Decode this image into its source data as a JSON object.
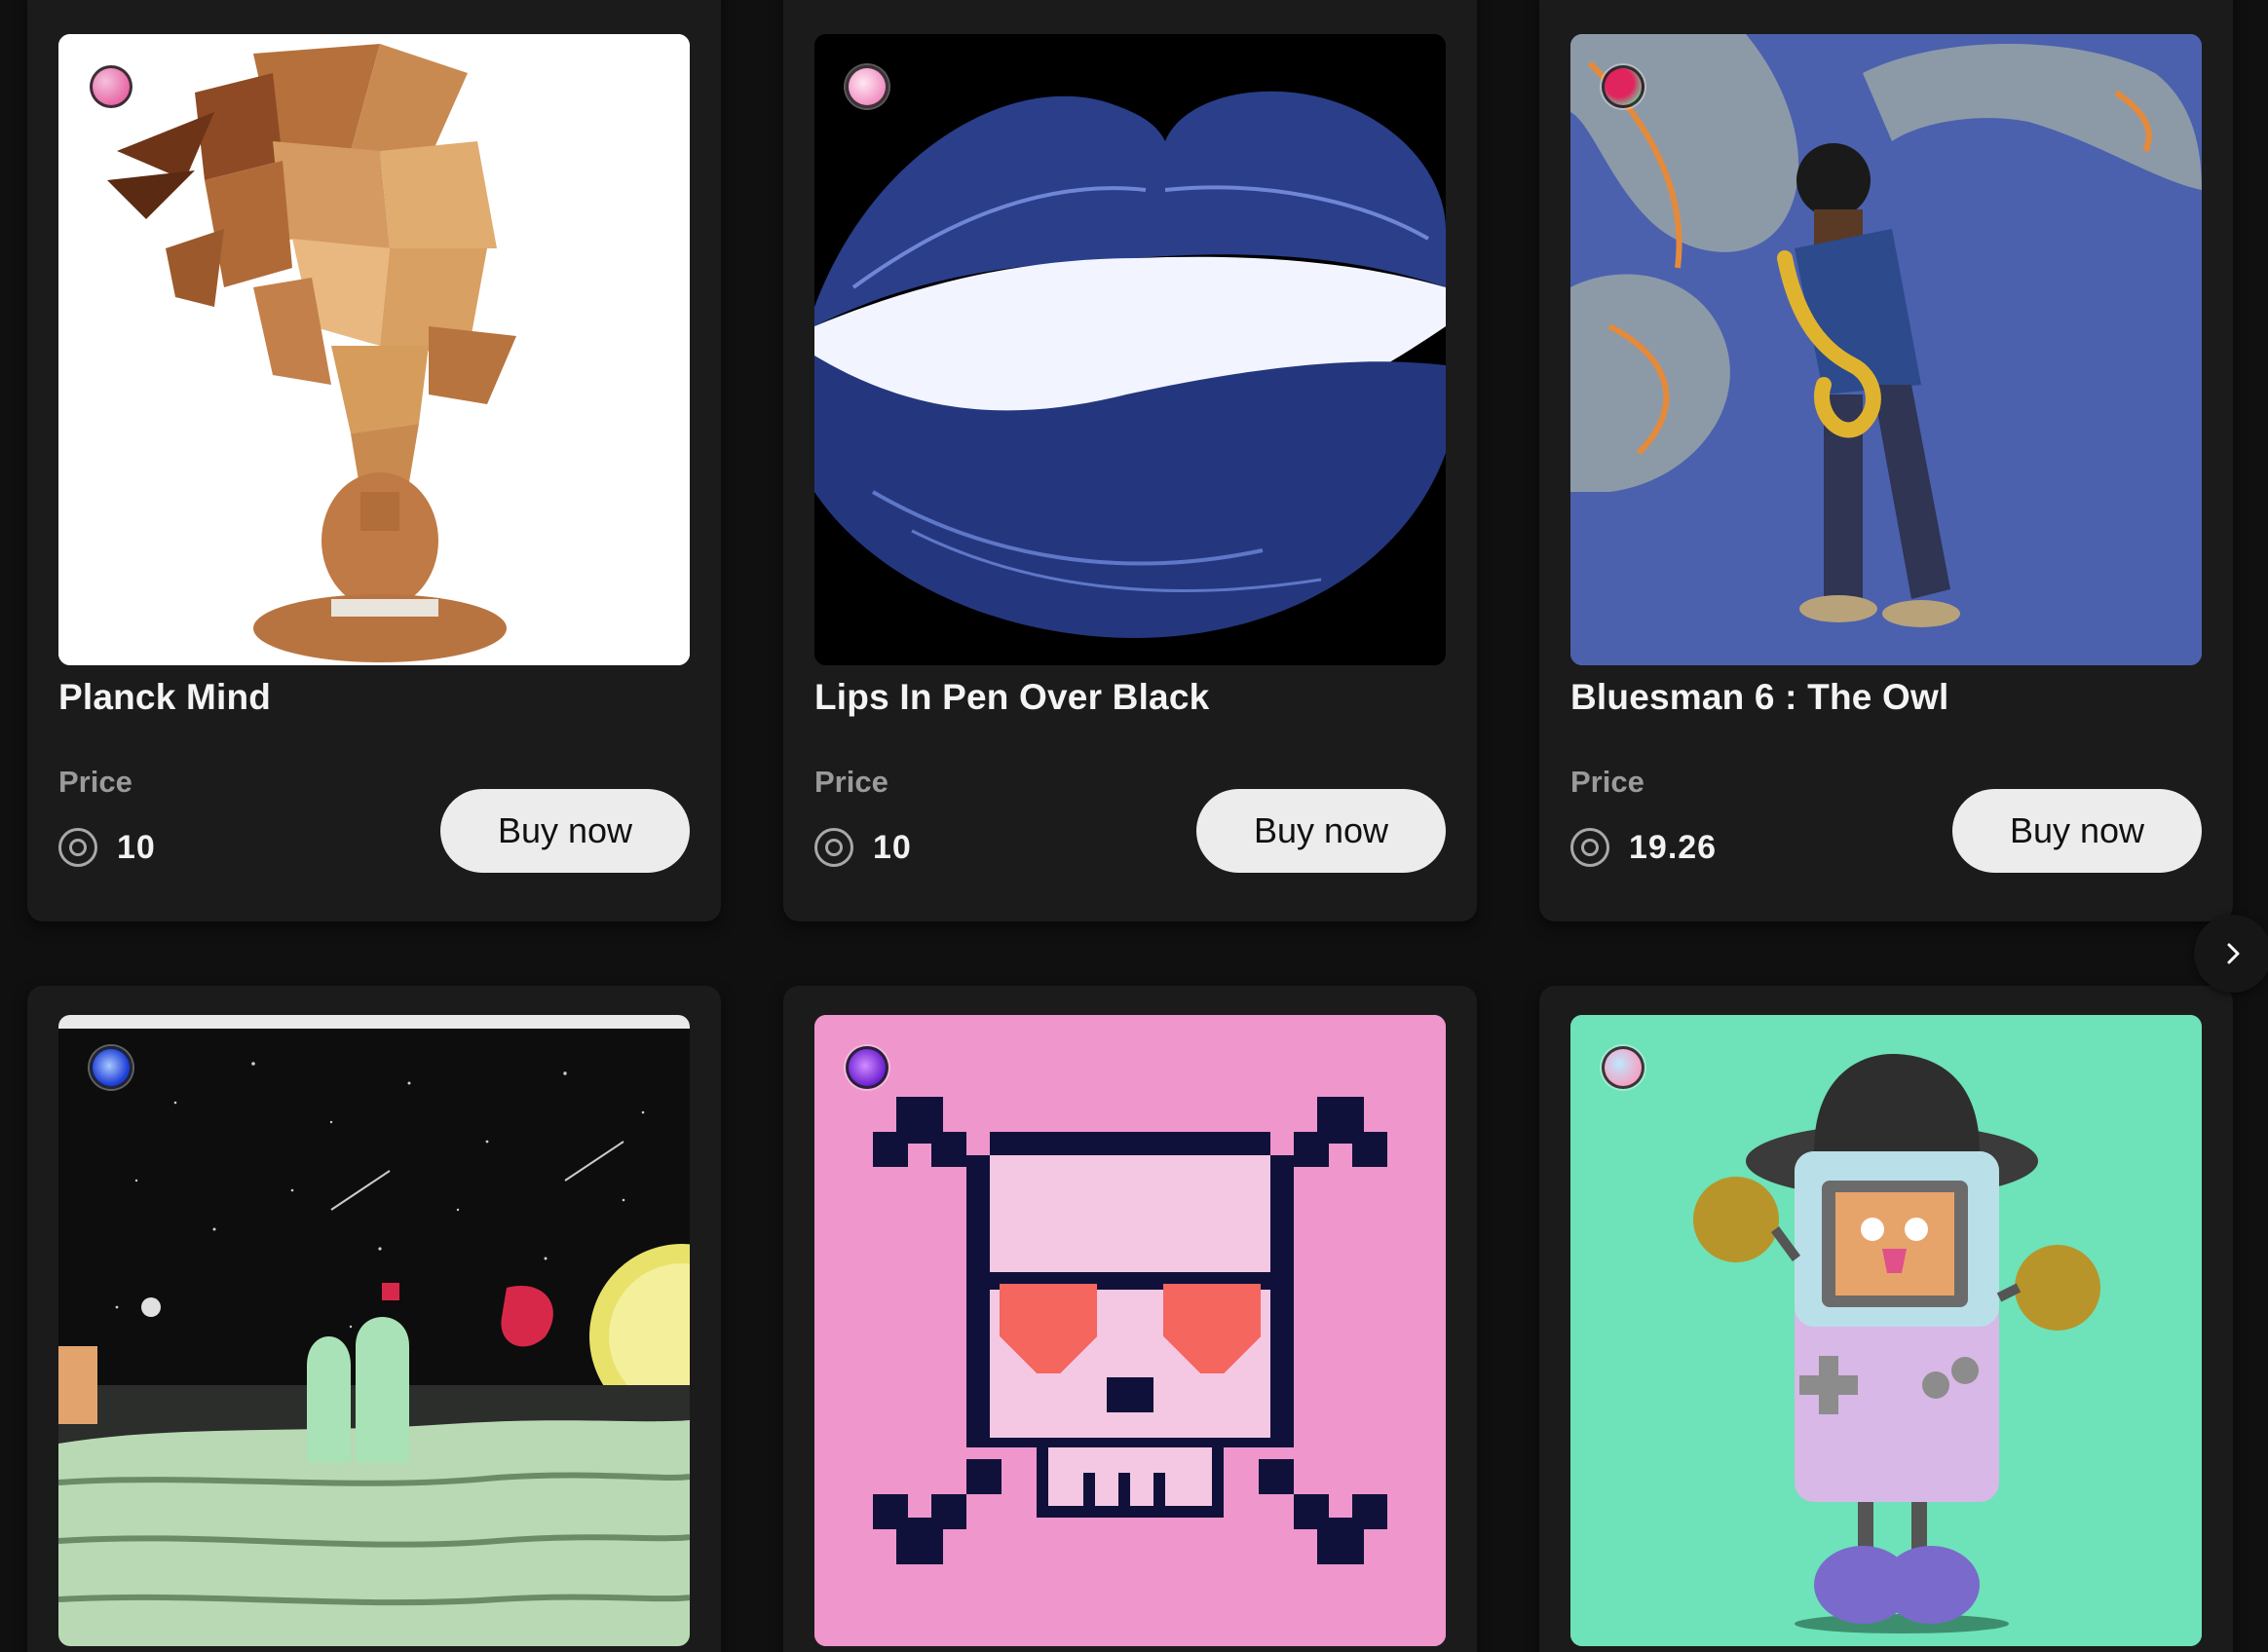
{
  "cards": [
    {
      "title": "Planck Mind",
      "price_label": "Price",
      "price": "10",
      "buy_label": "Buy now",
      "owner_dot_colors": [
        "#e86aa8",
        "#f4c1dc"
      ],
      "art": "wooden-shards-sitting-figure"
    },
    {
      "title": "Lips In Pen Over Black",
      "price_label": "Price",
      "price": "10",
      "buy_label": "Buy now",
      "owner_dot_colors": [
        "#f08ac0",
        "#ffe7f2"
      ],
      "art": "blue-pen-lips"
    },
    {
      "title": "Bluesman 6 : The Owl",
      "price_label": "Price",
      "price": "19.26",
      "buy_label": "Buy now",
      "owner_dot_colors": [
        "#e0245e",
        "#6fd3a0"
      ],
      "art": "saxophone-player-blue"
    },
    {
      "art": "space-landscape",
      "owner_dot_colors": [
        "#1e3fd6",
        "#a8c8ff"
      ]
    },
    {
      "art": "pixel-skull-crossbones-pink",
      "owner_dot_colors": [
        "#6a1fd0",
        "#d28cff"
      ]
    },
    {
      "art": "gameboy-character-mint",
      "owner_dot_colors": [
        "#f3a3c4",
        "#bfe7ff"
      ]
    }
  ],
  "icons": {
    "currency": "coin-icon",
    "next": "chevron-right-icon"
  },
  "colors": {
    "page_bg": "#101010",
    "card_bg": "#1b1b1b",
    "button_bg": "#ececec",
    "muted_text": "#9a9a9a"
  }
}
